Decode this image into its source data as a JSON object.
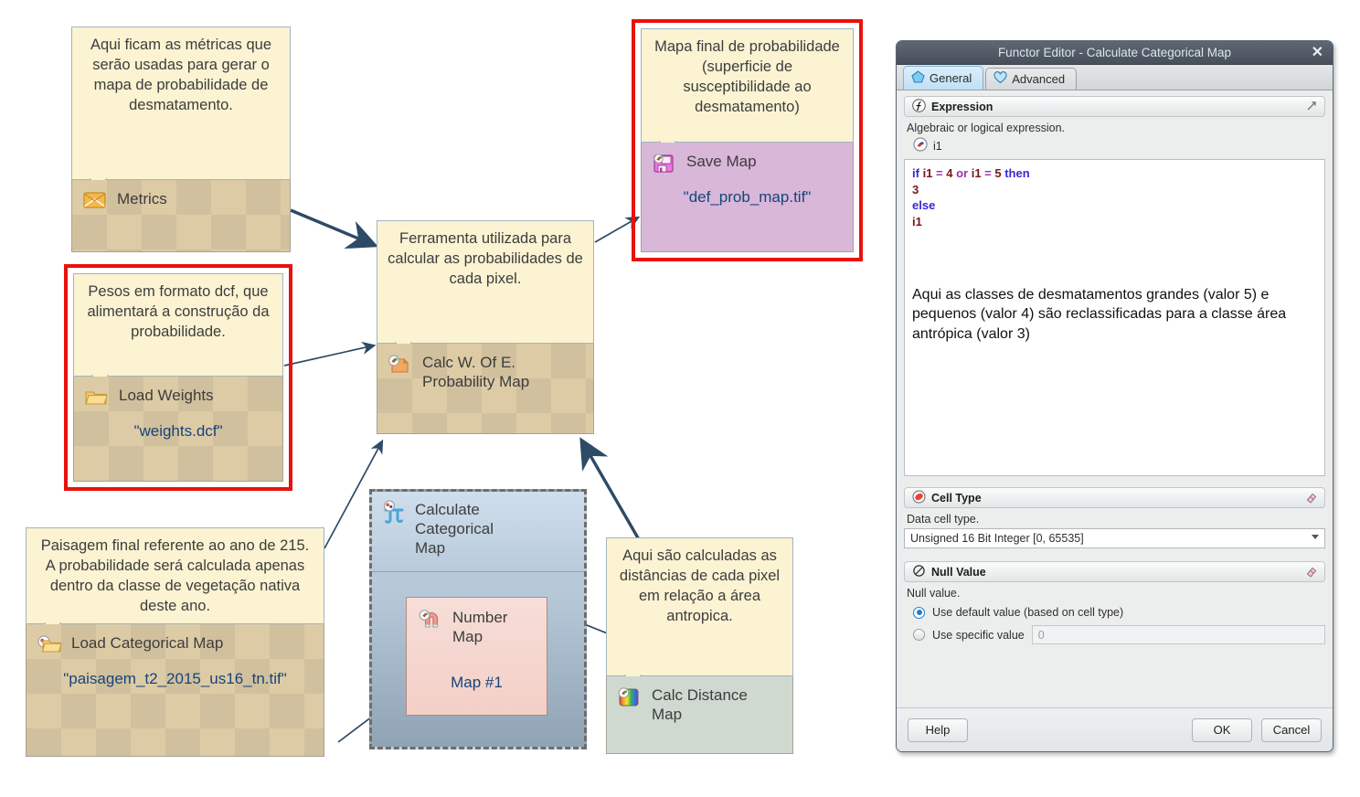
{
  "diagram": {
    "notes": {
      "metrics": "Aqui ficam as métricas que serão usadas para gerar o mapa de probabilidade de desmatamento.",
      "weights": "Pesos em formato dcf, que alimentará a construção da probabilidade.",
      "landscape": "Paisagem final referente ao ano de 215. A probabilidade será calculada apenas dentro da classe de vegetação nativa deste ano.",
      "calc_prob": "Ferramenta utilizada para calcular as probabilidades de cada pixel.",
      "save_map": "Mapa final de probabilidade (superficie de susceptibilidade ao desmatamento)",
      "distance": "Aqui são calculadas as distâncias de cada pixel em relação a área antropica."
    },
    "nodes": {
      "metrics": {
        "title": "Metrics"
      },
      "load_weights": {
        "title": "Load Weights",
        "file": "\"weights.dcf\""
      },
      "load_categorical_map": {
        "title": "Load Categorical Map",
        "file": "\"paisagem_t2_2015_us16_tn.tif\""
      },
      "calc_prob": {
        "title_line1": "Calc W. Of E.",
        "title_line2": "Probability Map"
      },
      "save_map": {
        "title": "Save Map",
        "file": "\"def_prob_map.tif\""
      },
      "calc_distance": {
        "title_line1": "Calc Distance",
        "title_line2": "Map"
      },
      "group": {
        "title_line1": "Calculate",
        "title_line2": "Categorical",
        "title_line3": "Map",
        "inner_title_line1": "Number",
        "inner_title_line2": "Map",
        "inner_value": "Map #1"
      }
    }
  },
  "dialog": {
    "title": "Functor Editor - Calculate Categorical Map",
    "close_label": "✕",
    "tabs": [
      {
        "label": "General",
        "active": true
      },
      {
        "label": "Advanced",
        "active": false
      }
    ],
    "expression": {
      "section_title": "Expression",
      "description": "Algebraic or logical expression.",
      "variable": "i1",
      "code": [
        {
          "line": [
            {
              "t": "if ",
              "c": "kw"
            },
            {
              "t": "i1",
              "c": "var"
            },
            {
              "t": " = ",
              "c": "op"
            },
            {
              "t": "4",
              "c": "num"
            },
            {
              "t": " or ",
              "c": "op"
            },
            {
              "t": "i1",
              "c": "var"
            },
            {
              "t": " = ",
              "c": "op"
            },
            {
              "t": "5",
              "c": "num"
            },
            {
              "t": " then",
              "c": "kw"
            }
          ]
        },
        {
          "line": [
            {
              "t": "   3",
              "c": "num"
            }
          ]
        },
        {
          "line": [
            {
              "t": "else",
              "c": "kw"
            }
          ]
        },
        {
          "line": [
            {
              "t": "   i1",
              "c": "var"
            }
          ]
        }
      ],
      "annotation": "Aqui as classes de desmatamentos grandes (valor 5) e pequenos (valor 4) são reclassificadas para a classe área antrópica (valor 3)"
    },
    "cell_type": {
      "section_title": "Cell Type",
      "description": "Data cell type.",
      "value": "Unsigned 16 Bit Integer [0, 65535]"
    },
    "null_value": {
      "section_title": "Null Value",
      "description": "Null value.",
      "option_default": "Use default value (based on cell type)",
      "option_specific": "Use specific value",
      "specific_value": "0"
    },
    "buttons": {
      "help": "Help",
      "ok": "OK",
      "cancel": "Cancel"
    }
  },
  "colors": {
    "note_bg": "#fbf3d2",
    "tan_body": "#ddcba6",
    "violet_body": "#d8b7d9",
    "sage_body": "#cfd9d0",
    "red_highlight": "#e8120c",
    "link_blue": "#16447c",
    "wire": "#2d4a66"
  }
}
